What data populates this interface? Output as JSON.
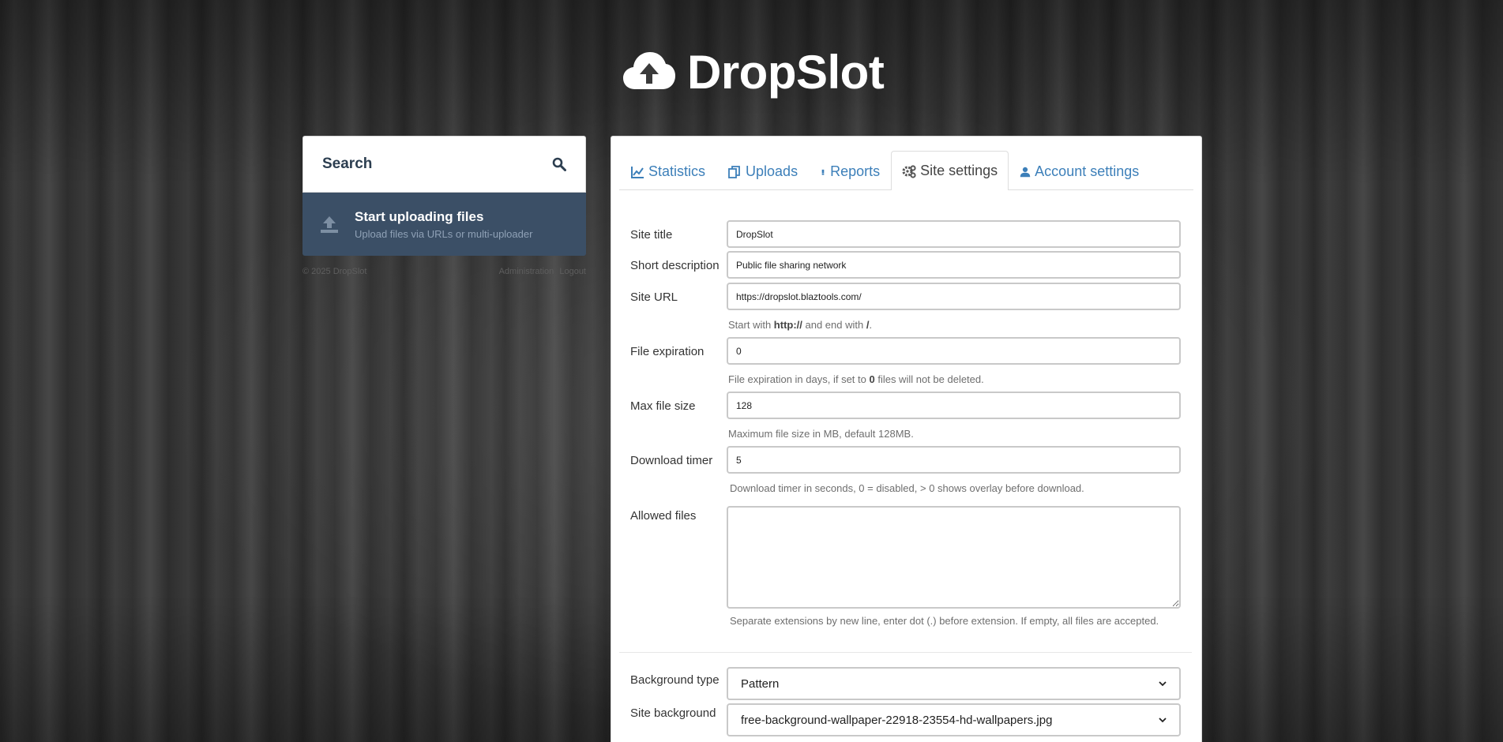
{
  "brand": {
    "name": "DropSlot",
    "icon": "cloud-upload-icon"
  },
  "sidebar": {
    "search_label": "Search",
    "upload_title": "Start uploading files",
    "upload_subtitle": "Upload files via URLs or multi-uploader",
    "footer_copyright": "© 2025 DropSlot",
    "footer_links": [
      "Administration",
      "Logout"
    ]
  },
  "tabs": [
    {
      "label": "Statistics",
      "icon": "chart-line-icon"
    },
    {
      "label": "Uploads",
      "icon": "copy-icon"
    },
    {
      "label": "Reports",
      "icon": "exclamation-icon"
    },
    {
      "label": "Site settings",
      "icon": "gears-icon",
      "active": true
    },
    {
      "label": "Account settings",
      "icon": "user-icon"
    }
  ],
  "form": {
    "site_title": {
      "label": "Site title",
      "value": "DropSlot"
    },
    "short_description": {
      "label": "Short description",
      "value": "Public file sharing network"
    },
    "site_url": {
      "label": "Site URL",
      "value": "https://dropslot.blaztools.com/",
      "hint_pre": "Start with ",
      "hint_b1": "http://",
      "hint_mid": " and end with ",
      "hint_b2": "/",
      "hint_post": "."
    },
    "file_expiration": {
      "label": "File expiration",
      "value": "0",
      "hint_pre": "File expiration in days, if set to ",
      "hint_b": "0",
      "hint_post": " files will not be deleted."
    },
    "max_file_size": {
      "label": "Max file size",
      "value": "128",
      "hint": "Maximum file size in MB, default 128MB."
    },
    "download_timer": {
      "label": "Download timer",
      "value": "5",
      "hint": "Download timer in seconds, 0 = disabled, > 0 shows overlay before download."
    },
    "allowed_files": {
      "label": "Allowed files",
      "value": "",
      "hint": "Separate extensions by new line, enter dot (.) before extension. If empty, all files are accepted."
    },
    "background_type": {
      "label": "Background type",
      "value": "Pattern"
    },
    "site_background": {
      "label": "Site background",
      "value": "free-background-wallpaper-22918-23554-hd-wallpapers.jpg"
    }
  }
}
